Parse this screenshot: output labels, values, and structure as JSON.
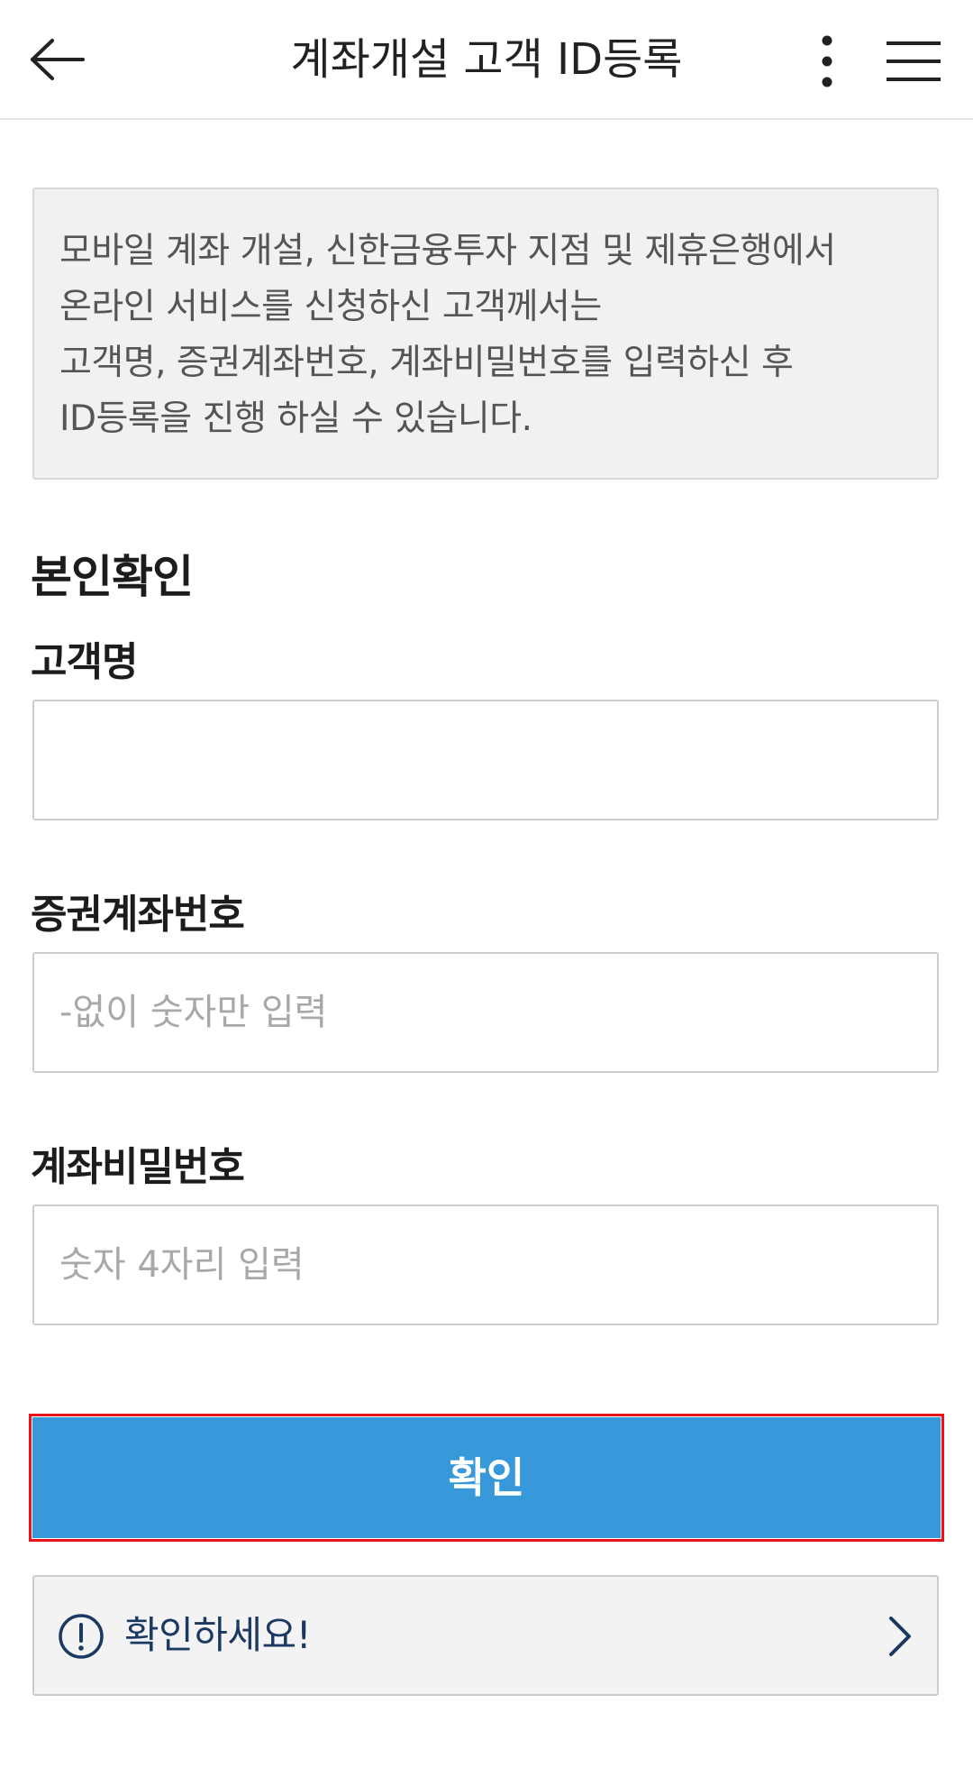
{
  "header": {
    "title": "계좌개설 고객 ID등록",
    "back_icon": "arrow-left-icon",
    "more_icon": "more-vertical-icon",
    "menu_icon": "hamburger-menu-icon"
  },
  "notice": {
    "lines": [
      "모바일 계좌 개설, 신한금융투자 지점 및 제휴은행에서",
      "온라인 서비스를 신청하신 고객께서는",
      "고객명, 증권계좌번호, 계좌비밀번호를 입력하신 후",
      "ID등록을 진행 하실 수 있습니다."
    ]
  },
  "form": {
    "section_title": "본인확인",
    "name": {
      "label": "고객명",
      "value": "",
      "placeholder": ""
    },
    "account": {
      "label": "증권계좌번호",
      "value": "",
      "placeholder": "-없이 숫자만 입력"
    },
    "password": {
      "label": "계좌비밀번호",
      "value": "",
      "placeholder": "숫자 4자리 입력"
    }
  },
  "confirm": {
    "label": "확인",
    "color": "#3799da",
    "highlight_color": "#e8141c"
  },
  "check": {
    "label": "확인하세요!",
    "icon": "exclamation-circle-icon",
    "arrow_icon": "chevron-right-icon",
    "color": "#1b3a63"
  }
}
